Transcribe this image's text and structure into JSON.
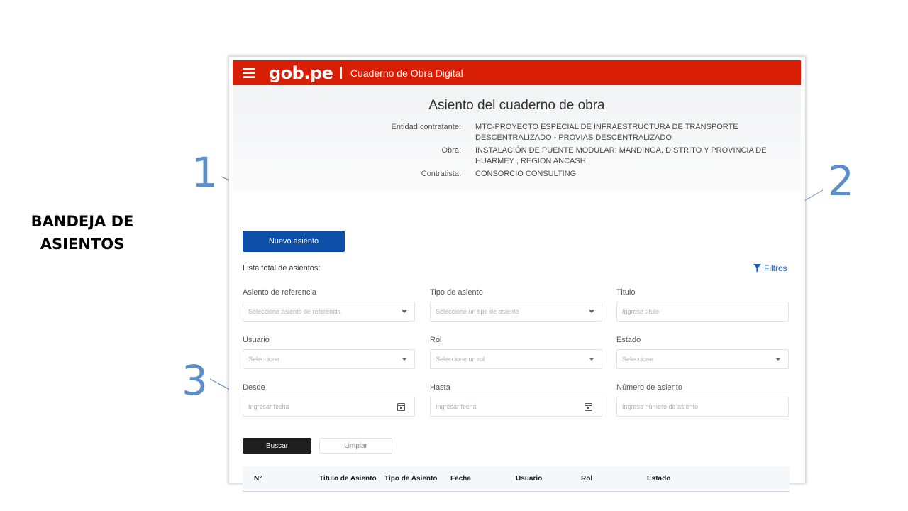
{
  "slide": {
    "side_title": "BANDEJA DE ASIENTOS",
    "callouts": [
      "1",
      "2",
      "3"
    ],
    "accent_color": "#5b8dc9"
  },
  "topbar": {
    "logo": "gob.pe",
    "app_title": "Cuaderno de Obra Digital",
    "menu_icon": "hamburger-menu-icon",
    "background": "#d81e05"
  },
  "page": {
    "title": "Asiento del cuaderno de obra",
    "meta": [
      {
        "label": "Entidad contratante:",
        "value": "MTC-PROYECTO ESPECIAL DE INFRAESTRUCTURA DE TRANSPORTE DESCENTRALIZADO - PROVIAS DESCENTRALIZADO"
      },
      {
        "label": "Obra:",
        "value": "INSTALACIÓN DE PUENTE MODULAR: MANDINGA, DISTRITO Y PROVINCIA DE HUARMEY , REGION ANCASH"
      },
      {
        "label": "Contratista:",
        "value": "CONSORCIO CONSULTING"
      }
    ]
  },
  "actions": {
    "new_entry": "Nuevo asiento",
    "list_label": "Lista total de asientos:",
    "filters": "Filtros",
    "search": "Buscar",
    "clear": "Limpiar",
    "primary_color": "#0d4fa8"
  },
  "filters": [
    {
      "label": "Asiento de referencia",
      "placeholder": "Seleccione asiento de referencia",
      "kind": "select"
    },
    {
      "label": "Tipo de asiento",
      "placeholder": "Seleccione un tipo de asiento",
      "kind": "select"
    },
    {
      "label": "Titulo",
      "placeholder": "Ingrese título",
      "kind": "text"
    },
    {
      "label": "Usuario",
      "placeholder": "Seleccione",
      "kind": "select"
    },
    {
      "label": "Rol",
      "placeholder": "Seleccione un rol",
      "kind": "select"
    },
    {
      "label": "Estado",
      "placeholder": "Seleccione",
      "kind": "select"
    },
    {
      "label": "Desde",
      "placeholder": "Ingresar fecha",
      "kind": "date"
    },
    {
      "label": "Hasta",
      "placeholder": "Ingresar fecha",
      "kind": "date"
    },
    {
      "label": "Número de asiento",
      "placeholder": "Ingrese número de asiento",
      "kind": "text"
    }
  ],
  "table": {
    "columns": [
      "N°",
      "Titulo de Asiento",
      "Tipo de Asiento",
      "Fecha",
      "Usuario",
      "Rol",
      "Estado"
    ]
  }
}
